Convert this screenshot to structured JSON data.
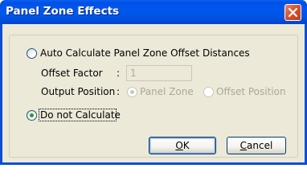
{
  "window": {
    "title": "Panel Zone Effects",
    "close_icon": "close-icon"
  },
  "options": {
    "auto_calculate_label": "Auto Calculate Panel Zone Offset Distances",
    "auto_calculate_selected": false,
    "offset_factor_label": "Offset Factor",
    "offset_factor_value": "1",
    "output_position_label": "Output Position",
    "colon": ":",
    "output_position_options": [
      {
        "label": "Panel Zone",
        "selected": true,
        "enabled": false
      },
      {
        "label": "Offset Position",
        "selected": false,
        "enabled": false
      }
    ],
    "do_not_calculate_label": "Do not Calculate",
    "do_not_calculate_selected": true
  },
  "buttons": {
    "ok_mnemonic": "O",
    "ok_rest": "K",
    "cancel_mnemonic": "C",
    "cancel_rest": "ancel"
  },
  "colors": {
    "titlebar": "#0054e3",
    "dialog_bg": "#ece9d8",
    "radio_dot": "#21a121",
    "disabled_text": "#aca899"
  }
}
